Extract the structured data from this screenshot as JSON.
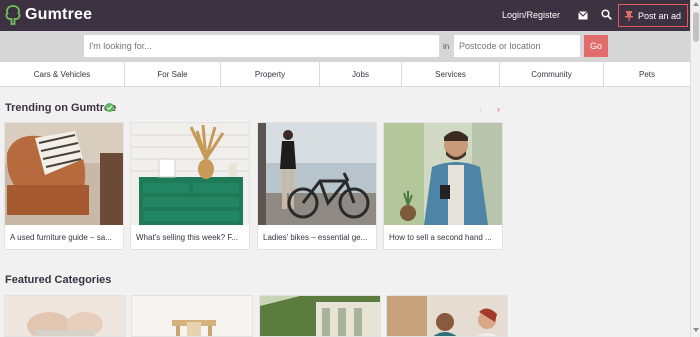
{
  "header": {
    "brand": "Gumtree",
    "login_label": "Login/Register",
    "post_ad_label": "Post an ad",
    "icons": [
      "gumtree-tree-icon",
      "mail-icon",
      "search-icon",
      "pin-icon"
    ]
  },
  "search": {
    "query_placeholder": "I'm looking for...",
    "in_label": "in",
    "location_placeholder": "Postcode or location",
    "go_label": "Go"
  },
  "categories": [
    "Cars & Vehicles",
    "For Sale",
    "Property",
    "Jobs",
    "Services",
    "Community",
    "Pets"
  ],
  "trending": {
    "title": "Trending on Gumtree",
    "prev_label": "‹",
    "next_label": "›",
    "cards": [
      {
        "caption": "A used furniture guide – sa..."
      },
      {
        "caption": "What's selling this week? F..."
      },
      {
        "caption": "Ladies' bikes – essential ge..."
      },
      {
        "caption": "How to sell a second hand ..."
      }
    ]
  },
  "featured": {
    "title": "Featured Categories"
  },
  "colors": {
    "header_bg": "#3c3241",
    "accent_red": "#e26b6b",
    "verified_green": "#5cb85c",
    "page_bg": "#f1f1f1"
  }
}
